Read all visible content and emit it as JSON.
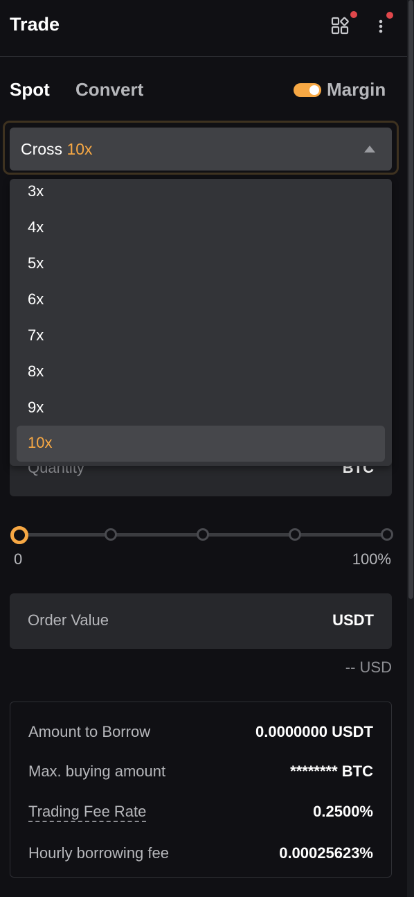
{
  "header": {
    "title": "Trade"
  },
  "tabs": {
    "spot": "Spot",
    "convert": "Convert"
  },
  "margin": {
    "label": "Margin",
    "enabled": true
  },
  "leverage": {
    "mode": "Cross",
    "current": "10x",
    "options": [
      "3x",
      "4x",
      "5x",
      "6x",
      "7x",
      "8x",
      "9x",
      "10x"
    ]
  },
  "quantity": {
    "label": "Quantity",
    "unit": "BTC"
  },
  "slider": {
    "min_label": "0",
    "max_label": "100%",
    "value_percent": 0
  },
  "order_value": {
    "label": "Order Value",
    "unit": "USDT",
    "usd_estimate": "-- USD"
  },
  "info": {
    "borrow_label": "Amount to Borrow",
    "borrow_value": "0.0000000 USDT",
    "max_buy_label": "Max. buying amount",
    "max_buy_value": "******** BTC",
    "fee_label": "Trading Fee Rate",
    "fee_value": "0.2500%",
    "hourly_label": "Hourly borrowing fee",
    "hourly_value": "0.00025623%"
  },
  "colors": {
    "accent": "#f7a844",
    "notification": "#e0474b",
    "background": "#101014"
  },
  "icons": {
    "grid": "apps-grid-icon",
    "menu": "more-vertical-icon",
    "caret": "caret-up-icon"
  }
}
